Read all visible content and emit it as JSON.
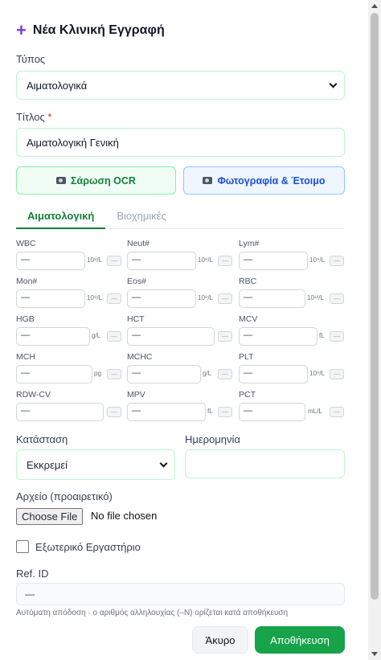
{
  "header": {
    "title": "Νέα Κλινική Εγγραφή",
    "icon": "plus-icon"
  },
  "type_field": {
    "label": "Τύπος",
    "value": "Αιματολογικά"
  },
  "title_field": {
    "label": "Τίτλος",
    "required_mark": "*",
    "value": "Αιματολογική Γενική"
  },
  "actions": {
    "ocr_label": "Σάρωση OCR",
    "photo_label": "Φωτογραφία & Έτοιμο"
  },
  "tabs": [
    {
      "label": "Αιματολογική",
      "active": true
    },
    {
      "label": "Βιοχημικές",
      "active": false
    }
  ],
  "lab_fields": [
    {
      "label": "WBC",
      "value": "—",
      "unit": "10⁹/L",
      "flag": "—"
    },
    {
      "label": "Neut#",
      "value": "—",
      "unit": "10⁹/L",
      "flag": "—"
    },
    {
      "label": "Lym#",
      "value": "—",
      "unit": "10⁹/L",
      "flag": "—"
    },
    {
      "label": "Mon#",
      "value": "—",
      "unit": "10⁹/L",
      "flag": "—"
    },
    {
      "label": "Eos#",
      "value": "—",
      "unit": "10⁹/L",
      "flag": "—"
    },
    {
      "label": "RBC",
      "value": "—",
      "unit": "10¹²/L",
      "flag": "—"
    },
    {
      "label": "HGB",
      "value": "—",
      "unit": "g/L",
      "flag": "—"
    },
    {
      "label": "HCT",
      "value": "—",
      "unit": "",
      "flag": "—"
    },
    {
      "label": "MCV",
      "value": "—",
      "unit": "fL",
      "flag": "—"
    },
    {
      "label": "MCH",
      "value": "—",
      "unit": "pg",
      "flag": "—"
    },
    {
      "label": "MCHC",
      "value": "—",
      "unit": "g/L",
      "flag": "—"
    },
    {
      "label": "PLT",
      "value": "—",
      "unit": "10⁹/L",
      "flag": "—"
    },
    {
      "label": "RDW-CV",
      "value": "—",
      "unit": "",
      "flag": "—"
    },
    {
      "label": "MPV",
      "value": "—",
      "unit": "fL",
      "flag": "—"
    },
    {
      "label": "PCT",
      "value": "—",
      "unit": "mL/L",
      "flag": "—"
    }
  ],
  "status_field": {
    "label": "Κατάσταση",
    "value": "Εκκρεμεί"
  },
  "date_field": {
    "label": "Ημερομηνία",
    "value": ""
  },
  "file_field": {
    "label": "Αρχείο (προαιρετικό)",
    "button": "Choose File",
    "status": "No file chosen"
  },
  "external_lab": {
    "label": "Εξωτερικό Εργαστήριο",
    "checked": false
  },
  "ref_field": {
    "label": "Ref. ID",
    "value": "—",
    "hint": "Αυτόματη απόδοση · ο αριθμός αλληλουχίας (–N) ορίζεται κατά αποθήκευση"
  },
  "footer": {
    "cancel_label": "Άκυρο",
    "save_label": "Αποθήκευση"
  }
}
